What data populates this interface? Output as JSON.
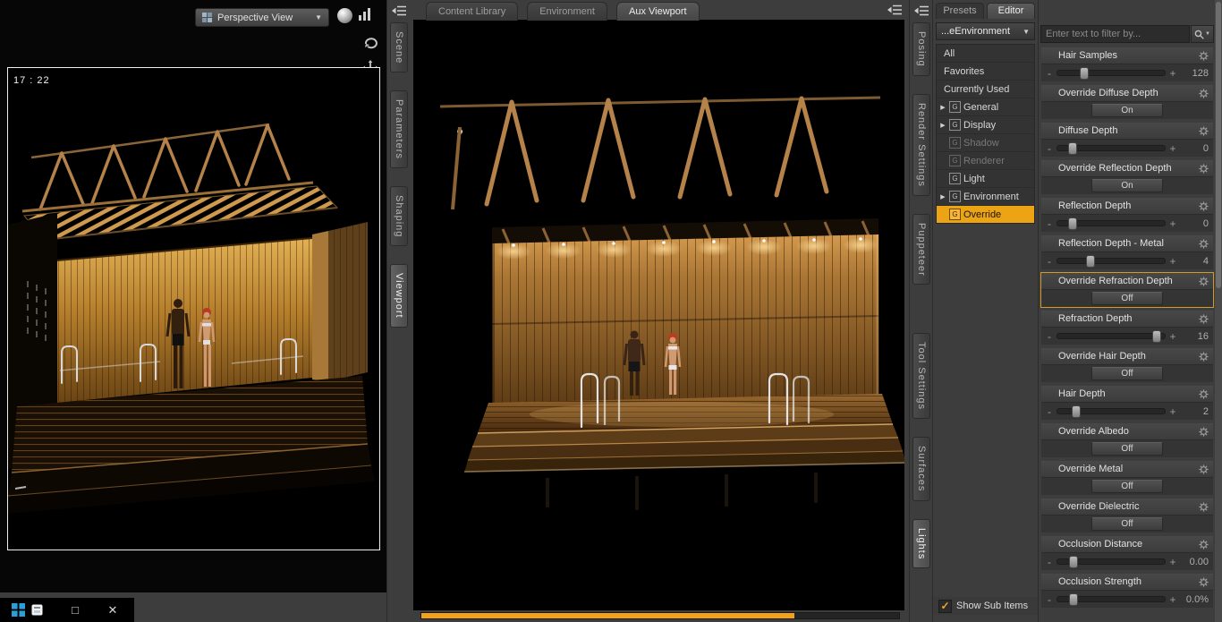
{
  "accent_color": "#f2a21a",
  "icons": {
    "chevron_down": "▼",
    "expand_arrow": "▶",
    "minus": "-",
    "plus": "+",
    "check": "✓",
    "group_letter": "G",
    "maximize": "□",
    "close": "✕"
  },
  "left_viewport": {
    "view_dropdown_label": "Perspective View",
    "timestamp": "17 : 22",
    "tabs": [
      {
        "label": "Scene",
        "active": false
      },
      {
        "label": "Parameters",
        "active": false
      },
      {
        "label": "Shaping",
        "active": false
      },
      {
        "label": "Viewport",
        "active": true
      }
    ]
  },
  "center": {
    "tabs": [
      {
        "label": "Content Library",
        "active": false
      },
      {
        "label": "Environment",
        "active": false
      },
      {
        "label": "Aux Viewport",
        "active": true
      }
    ],
    "progress_pct": 78
  },
  "right_tab_strip": [
    {
      "label": "Posing",
      "active": false
    },
    {
      "label": "Render Settings",
      "active": false
    },
    {
      "label": "Puppeteer",
      "active": false
    },
    {
      "label": "Tool Settings",
      "active": false
    },
    {
      "label": "Surfaces",
      "active": false
    },
    {
      "label": "Lights",
      "active": true
    }
  ],
  "editor_panel": {
    "tabs": [
      {
        "label": "Presets",
        "active": false
      },
      {
        "label": "Editor",
        "active": true
      }
    ],
    "category_dropdown": "...eEnvironment",
    "items": [
      {
        "label": "All",
        "type": "plain"
      },
      {
        "label": "Favorites",
        "type": "plain"
      },
      {
        "label": "Currently Used",
        "type": "plain"
      },
      {
        "label": "General",
        "type": "group",
        "expandable": true
      },
      {
        "label": "Display",
        "type": "group",
        "expandable": true
      },
      {
        "label": "Shadow",
        "type": "group",
        "disabled": true
      },
      {
        "label": "Renderer",
        "type": "group",
        "disabled": true
      },
      {
        "label": "Light",
        "type": "group"
      },
      {
        "label": "Environment",
        "type": "group",
        "expandable": true
      },
      {
        "label": "Override",
        "type": "group",
        "selected": true
      }
    ],
    "show_sub_items_label": "Show Sub Items",
    "show_sub_items_checked": true
  },
  "params_panel": {
    "filter_placeholder": "Enter text to filter by...",
    "params": [
      {
        "label": "Hair Samples",
        "control": "slider",
        "value": "128",
        "pct": 24
      },
      {
        "label": "Override Diffuse Depth",
        "control": "toggle",
        "value": "On"
      },
      {
        "label": "Diffuse Depth",
        "control": "slider",
        "value": "0",
        "pct": 13
      },
      {
        "label": "Override Reflection Depth",
        "control": "toggle",
        "value": "On"
      },
      {
        "label": "Reflection Depth",
        "control": "slider",
        "value": "0",
        "pct": 13
      },
      {
        "label": "Reflection Depth - Metal",
        "control": "slider",
        "value": "4",
        "pct": 30
      },
      {
        "label": "Override Refraction Depth",
        "control": "toggle",
        "value": "Off",
        "selected": true
      },
      {
        "label": "Refraction Depth",
        "control": "slider",
        "value": "16",
        "pct": 92
      },
      {
        "label": "Override Hair Depth",
        "control": "toggle",
        "value": "Off"
      },
      {
        "label": "Hair Depth",
        "control": "slider",
        "value": "2",
        "pct": 17
      },
      {
        "label": "Override Albedo",
        "control": "toggle",
        "value": "Off"
      },
      {
        "label": "Override Metal",
        "control": "toggle",
        "value": "Off"
      },
      {
        "label": "Override Dielectric",
        "control": "toggle",
        "value": "Off"
      },
      {
        "label": "Occlusion Distance",
        "control": "slider",
        "value": "0.00",
        "pct": 14
      },
      {
        "label": "Occlusion Strength",
        "control": "slider",
        "value": "0.0%",
        "pct": 14
      }
    ]
  }
}
